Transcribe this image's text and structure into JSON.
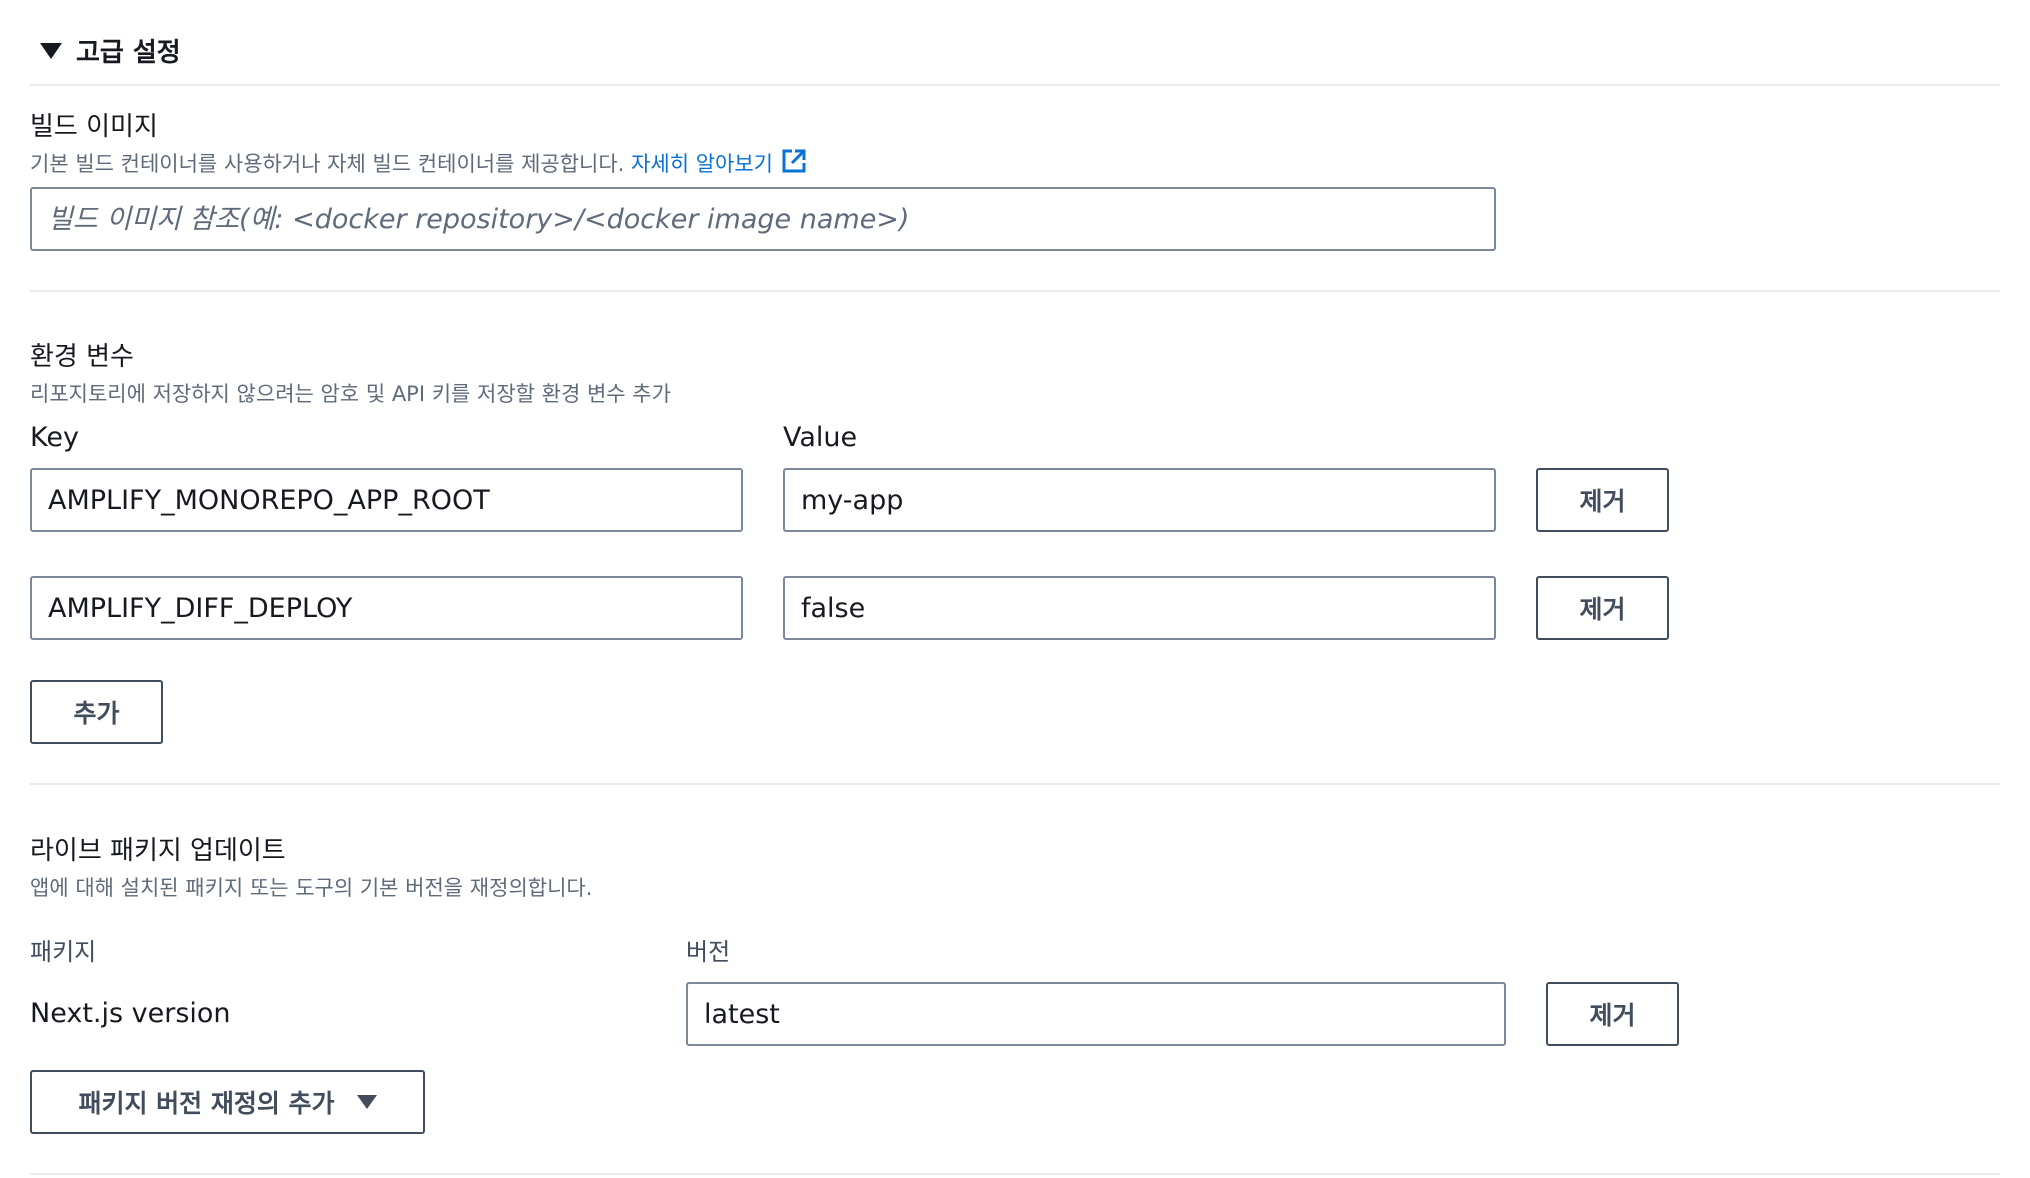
{
  "advanced": {
    "title": "고급 설정"
  },
  "build_image": {
    "title": "빌드 이미지",
    "description": "기본 빌드 컨테이너를 사용하거나 자체 빌드 컨테이너를 제공합니다.",
    "learn_more": "자세히 알아보기",
    "placeholder": "빌드 이미지 참조(예: <docker repository>/<docker image name>)",
    "value": ""
  },
  "env_vars": {
    "title": "환경 변수",
    "description": "리포지토리에 저장하지 않으려는 암호 및 API 키를 저장할 환경 변수 추가",
    "key_header": "Key",
    "value_header": "Value",
    "rows": [
      {
        "key": "AMPLIFY_MONOREPO_APP_ROOT",
        "value": "my-app",
        "remove_label": "제거"
      },
      {
        "key": "AMPLIFY_DIFF_DEPLOY",
        "value": "false",
        "remove_label": "제거"
      }
    ],
    "add_label": "추가"
  },
  "live_packages": {
    "title": "라이브 패키지 업데이트",
    "description": "앱에 대해 설치된 패키지 또는 도구의 기본 버전을 재정의합니다.",
    "package_header": "패키지",
    "version_header": "버전",
    "rows": [
      {
        "package": "Next.js version",
        "version": "latest",
        "remove_label": "제거"
      }
    ],
    "add_override_label": "패키지 버전 재정의 추가"
  },
  "colors": {
    "link": "#0972d3",
    "text": "#16191f",
    "muted": "#5f6b7a",
    "border": "#7d8998",
    "divider": "#e9ebed"
  }
}
